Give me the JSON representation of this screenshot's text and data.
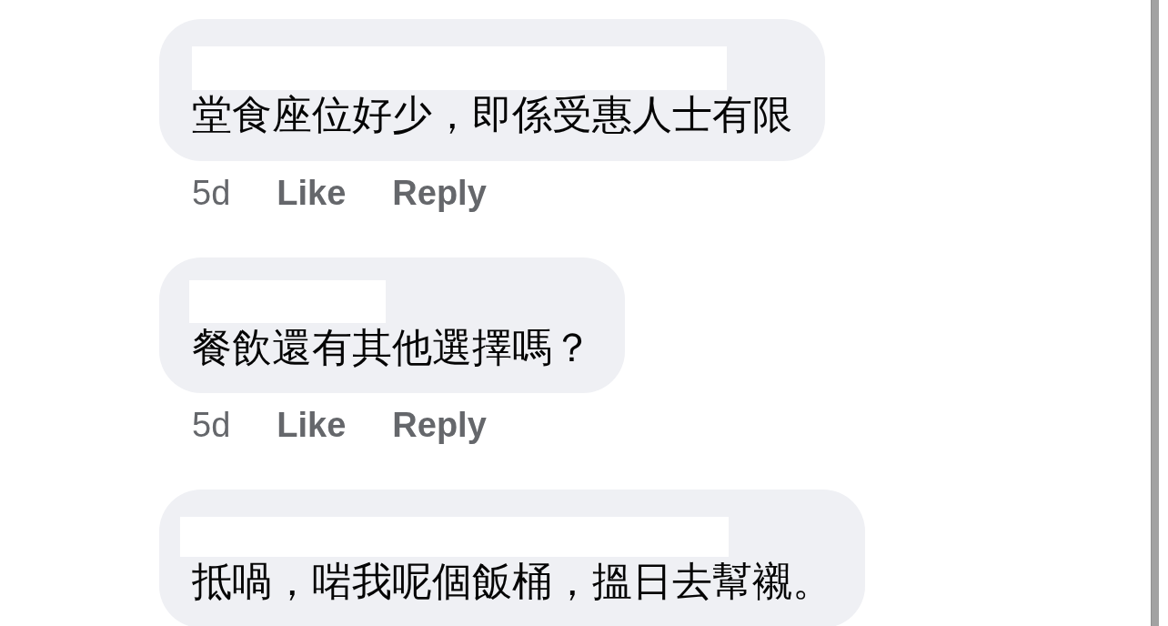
{
  "comments": [
    {
      "author_redacted": true,
      "text": "堂食座位好少，即係受惠人士有限",
      "time": "5d",
      "actions": [
        "Like",
        "Reply"
      ]
    },
    {
      "author_redacted": true,
      "text": "餐飲還有其他選擇嗎？",
      "time": "5d",
      "actions": [
        "Like",
        "Reply"
      ]
    },
    {
      "author_redacted": true,
      "text": "抵喎，啱我呢個飯桶，搵日去幫襯。"
    }
  ]
}
